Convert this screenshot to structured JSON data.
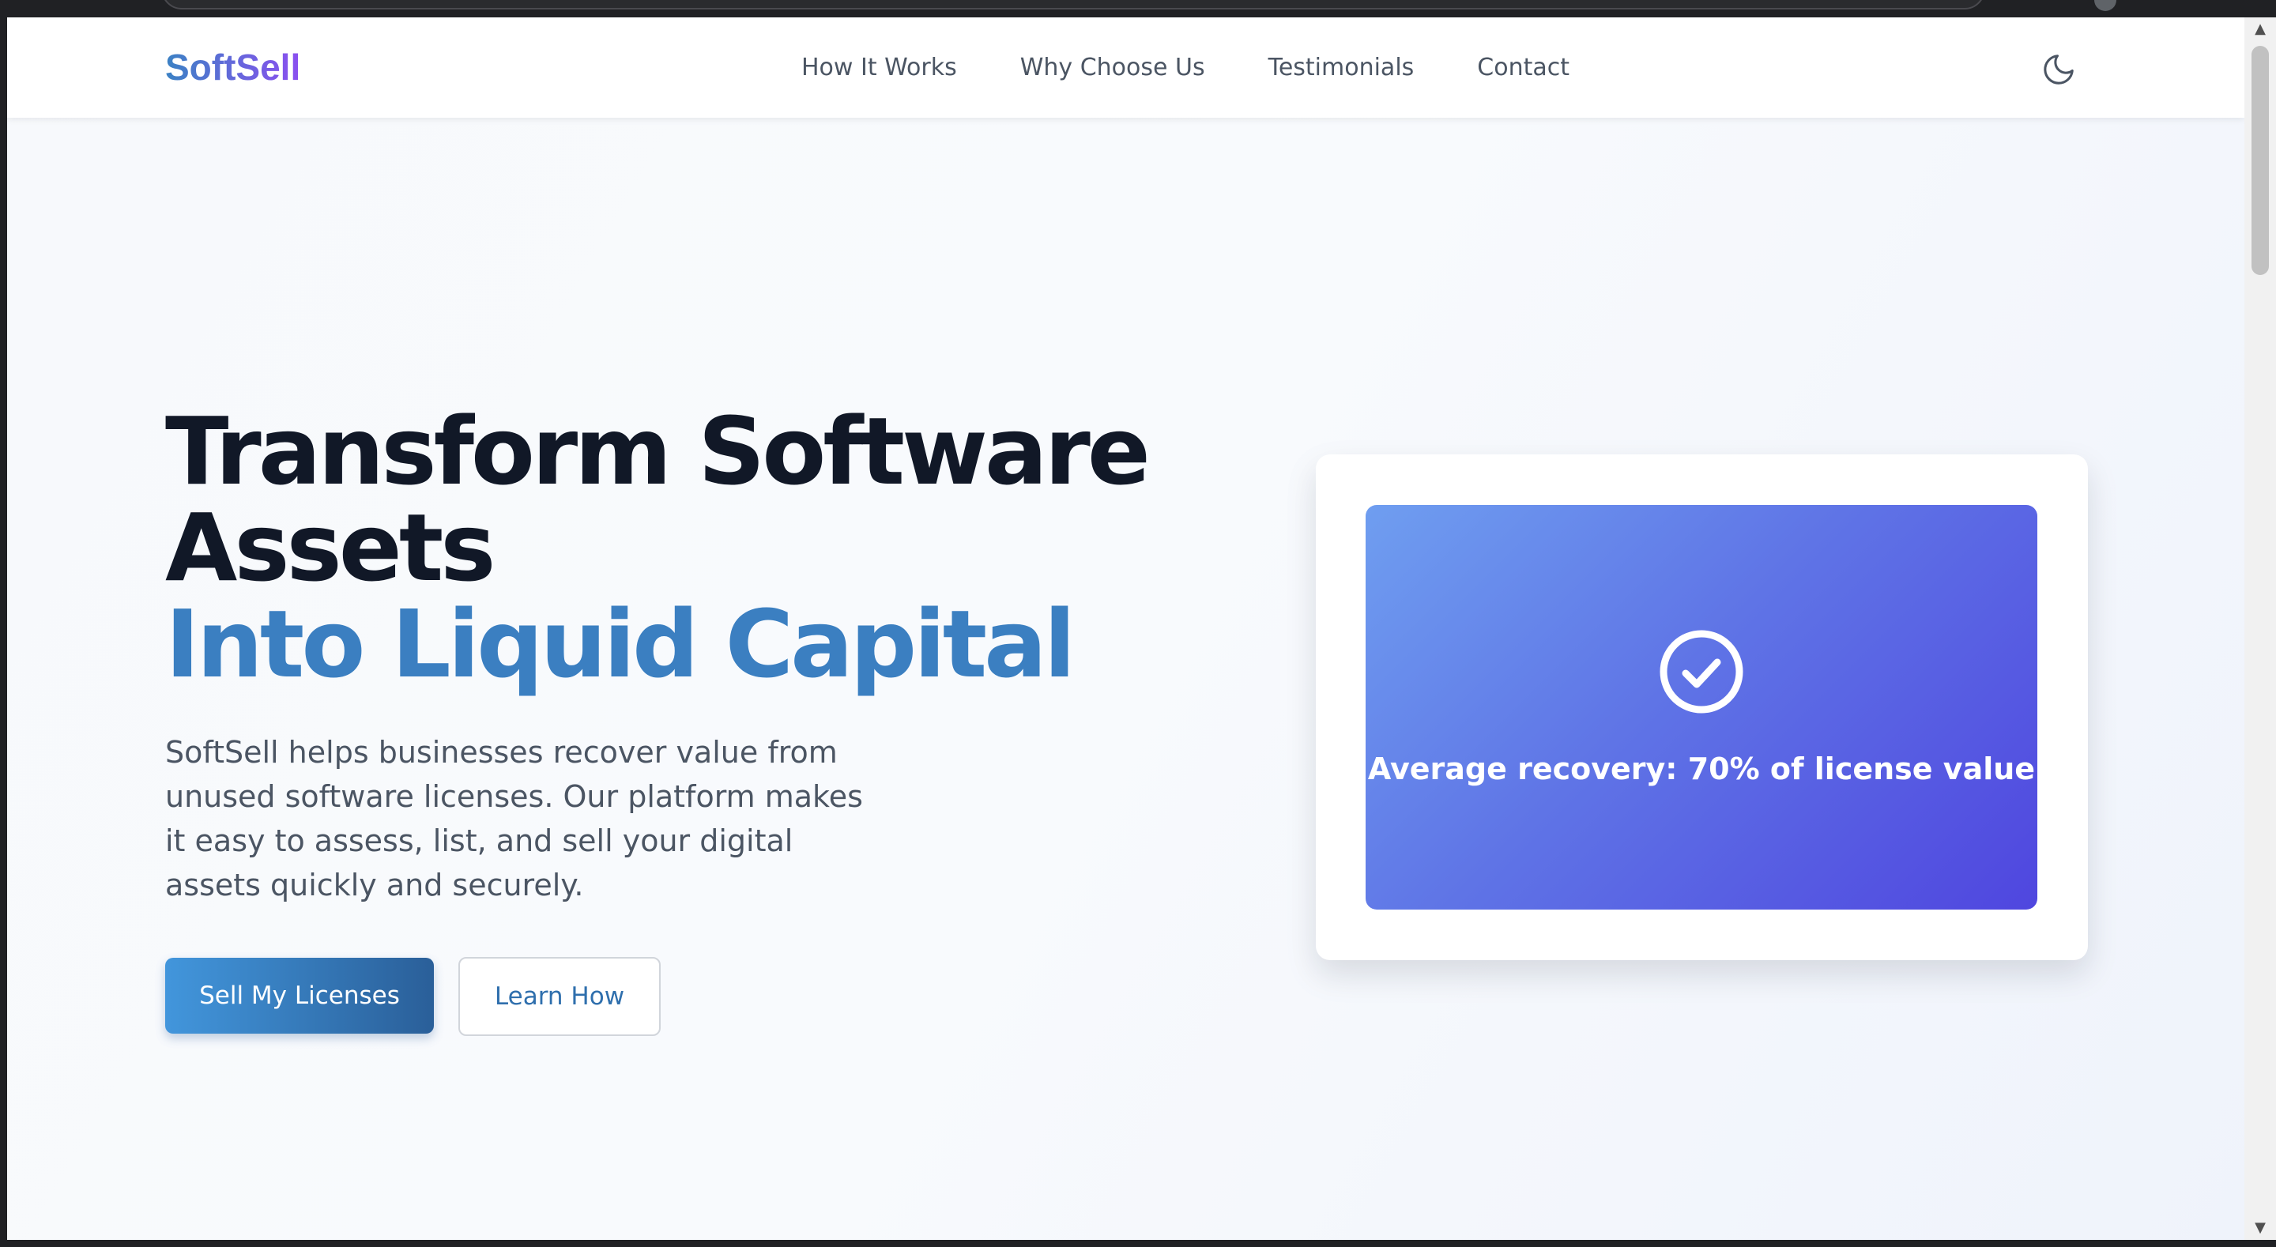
{
  "header": {
    "logo": "SoftSell",
    "nav": [
      {
        "label": "How It Works"
      },
      {
        "label": "Why Choose Us"
      },
      {
        "label": "Testimonials"
      },
      {
        "label": "Contact"
      }
    ],
    "theme_toggle_icon": "moon-icon"
  },
  "hero": {
    "title_line1": "Transform Software",
    "title_line2": "Assets",
    "title_line3": "Into Liquid Capital",
    "description": "SoftSell helps businesses recover value from unused software licenses. Our platform makes it easy to assess, list, and sell your digital assets quickly and securely.",
    "primary_button": "Sell My Licenses",
    "secondary_button": "Learn How"
  },
  "card": {
    "icon": "check-circle-icon",
    "stat_text": "Average recovery: 70% of license value"
  },
  "colors": {
    "brand_blue": "#3b7fc1",
    "brand_purple": "#8b4ff0",
    "heading": "#111827",
    "body_text": "#4b5563",
    "panel_gradient_start": "#6f9ef0",
    "panel_gradient_end": "#4f46df"
  }
}
